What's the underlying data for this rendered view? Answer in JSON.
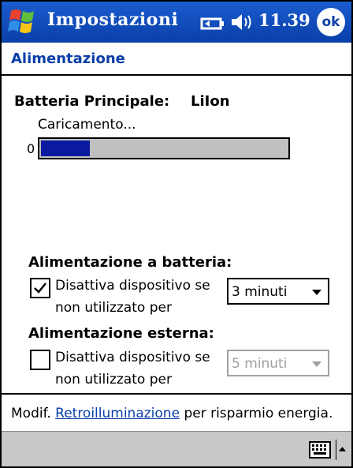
{
  "titlebar": {
    "title": "Impostazioni",
    "clock": "11.39",
    "ok_label": "ok"
  },
  "page": {
    "title": "Alimentazione"
  },
  "battery": {
    "label": "Batteria Principale:",
    "type": "LiIon",
    "status": "Caricamento...",
    "progress_min_label": "0",
    "progress_fraction": 0.2
  },
  "battery_power": {
    "heading": "Alimentazione a batteria:",
    "checkbox_checked": true,
    "desc_line1": "Disattiva dispositivo se",
    "desc_line2": "non utilizzato per",
    "selected": "3 minuti"
  },
  "external_power": {
    "heading": "Alimentazione esterna:",
    "checkbox_checked": false,
    "desc_line1": "Disattiva dispositivo se",
    "desc_line2": "non utilizzato per",
    "selected": "5 minuti"
  },
  "footer": {
    "prefix": "Modif.",
    "link": "Retroilluminazione",
    "suffix": "per risparmio energia."
  },
  "colors": {
    "titlebar": "#0a3fa8",
    "progress_fill": "#0a1aa0",
    "link": "#0a3fa8"
  }
}
